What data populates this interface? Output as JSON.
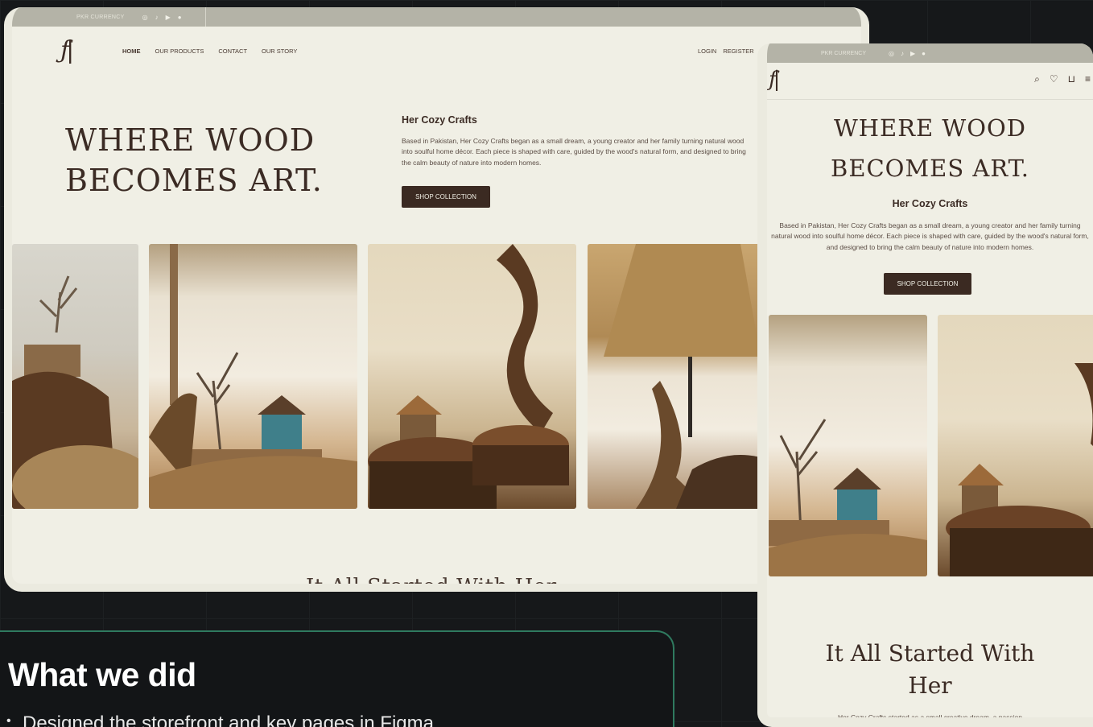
{
  "desktop": {
    "topbar": {
      "currency": "PKR CURRENCY",
      "social_icons": [
        "instagram-icon",
        "tiktok-icon",
        "youtube-icon",
        "facebook-icon"
      ]
    },
    "nav": {
      "links": [
        "HOME",
        "OUR PRODUCTS",
        "CONTACT",
        "OUR STORY"
      ],
      "login": "LOGIN",
      "register": "REGISTER"
    },
    "hero": {
      "title_line1": "WHERE WOOD",
      "title_line2": "BECOMES ART."
    },
    "brand": {
      "name": "Her Cozy Crafts",
      "description": "Based in Pakistan, Her Cozy Crafts began as a small dream, a young creator and her family turning natural wood into soulful home décor. Each piece is shaped with care, guided by the wood's natural form, and designed to bring the calm beauty of nature into modern homes."
    },
    "cta": "SHOP COLLECTION",
    "section_title": "It All Started With Her"
  },
  "mobile": {
    "topbar": {
      "currency": "PKR CURRENCY"
    },
    "icons": [
      "search-icon",
      "heart-icon",
      "bag-icon",
      "menu-icon"
    ],
    "hero": {
      "title_line1": "WHERE WOOD",
      "title_line2": "BECOMES ART."
    },
    "brand": {
      "name": "Her Cozy Crafts",
      "description": "Based in Pakistan, Her Cozy Crafts began as a small dream, a young creator and her family turning natural wood into soulful home décor. Each piece is shaped with care, guided by the wood's natural form, and designed to bring the calm beauty of nature into modern homes."
    },
    "cta": "SHOP COLLECTION",
    "section_title_line1": "It All Started With",
    "section_title_line2": "Her",
    "section_intro": "Her Cozy Crafts started as a small creative dream, a passion"
  },
  "card": {
    "title": "What we did",
    "items": [
      "Designed the storefront and key pages in Figma"
    ]
  },
  "colors": {
    "bg": "#16181a",
    "page": "#f0efe5",
    "brown": "#3b2a22",
    "accent_green": "#2f7a5f"
  }
}
